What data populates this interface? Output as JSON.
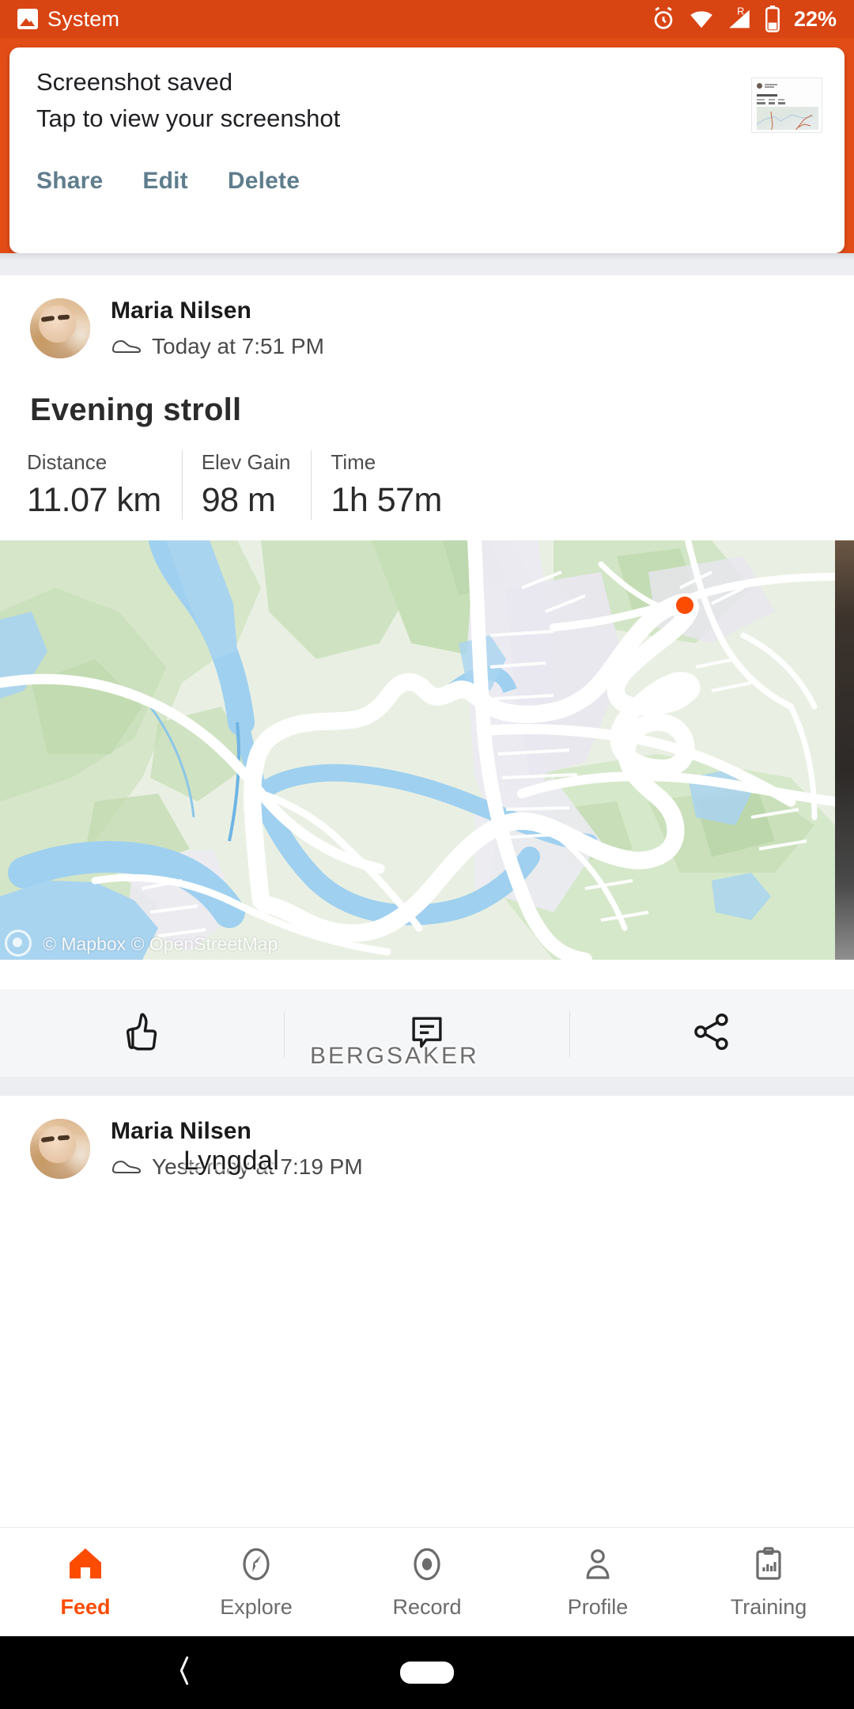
{
  "statusbar": {
    "app_label": "System",
    "battery_percent": "22%",
    "icons": [
      "image-icon",
      "alarm-icon",
      "wifi-icon",
      "cellular-roaming-icon",
      "battery-icon"
    ],
    "background_color": "#d94413"
  },
  "notification": {
    "title": "Screenshot saved",
    "subtitle": "Tap to view your screenshot",
    "actions": [
      {
        "label": "Share",
        "name": "share-action"
      },
      {
        "label": "Edit",
        "name": "edit-action"
      },
      {
        "label": "Delete",
        "name": "delete-action"
      }
    ],
    "thumbnail_name": "screenshot-thumbnail",
    "action_color": "#5f7d8c"
  },
  "feed": {
    "activities": [
      {
        "athlete": "Maria Nilsen",
        "time": "Today at 7:51 PM",
        "sport_icon": "shoe-icon",
        "title": "Evening stroll",
        "stats": [
          {
            "label": "Distance",
            "value": "11.07 km"
          },
          {
            "label": "Elev Gain",
            "value": "98 m"
          },
          {
            "label": "Time",
            "value": "1h 57m"
          }
        ],
        "map": {
          "labels": [
            "BERGSAKER",
            "Lyngdal"
          ],
          "attribution": "© Mapbox © OpenStreetMap",
          "route_color": "#fc4c02"
        },
        "social": [
          {
            "name": "kudos-button",
            "icon": "thumbs-up-icon"
          },
          {
            "name": "comment-button",
            "icon": "comment-icon"
          },
          {
            "name": "share-button",
            "icon": "share-icon"
          }
        ]
      },
      {
        "athlete": "Maria Nilsen",
        "time": "Yesterday at 7:19 PM",
        "sport_icon": "shoe-icon"
      }
    ]
  },
  "bottomnav": {
    "active": "Feed",
    "accent_color": "#fc4c02",
    "items": [
      {
        "label": "Feed",
        "icon": "home-icon",
        "active": true
      },
      {
        "label": "Explore",
        "icon": "compass-icon",
        "active": false
      },
      {
        "label": "Record",
        "icon": "record-icon",
        "active": false
      },
      {
        "label": "Profile",
        "icon": "person-icon",
        "active": false
      },
      {
        "label": "Training",
        "icon": "clipboard-chart-icon",
        "active": false
      }
    ]
  },
  "androidnav": {
    "back_icon": "back-chevron-icon",
    "home_icon": "home-pill-icon"
  }
}
